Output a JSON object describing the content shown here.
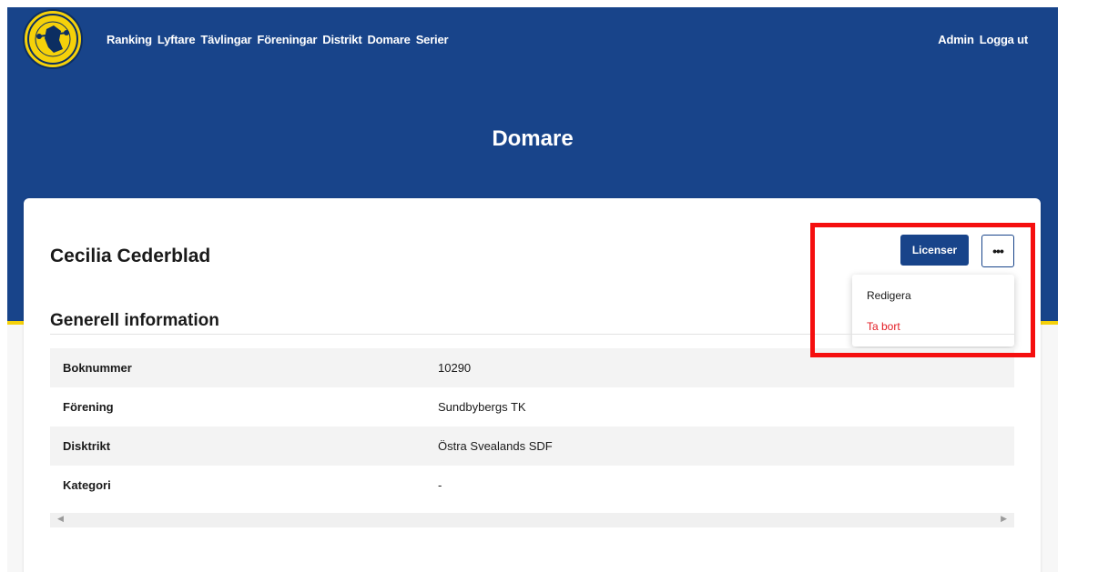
{
  "nav": {
    "items": [
      {
        "label": "Ranking"
      },
      {
        "label": "Lyftare"
      },
      {
        "label": "Tävlingar"
      },
      {
        "label": "Föreningar"
      },
      {
        "label": "Distrikt"
      },
      {
        "label": "Domare"
      },
      {
        "label": "Serier"
      }
    ],
    "right": [
      {
        "label": "Admin"
      },
      {
        "label": "Logga ut"
      }
    ],
    "logo_icon": "federation-logo-icon"
  },
  "page": {
    "title": "Domare"
  },
  "card": {
    "name": "Cecilia Cederblad",
    "section_title": "Generell information",
    "licenser_label": "Licenser",
    "more_label": "•••",
    "menu": {
      "edit_label": "Redigera",
      "delete_label": "Ta bort"
    },
    "rows": [
      {
        "label": "Boknummer",
        "value": "10290"
      },
      {
        "label": "Förening",
        "value": "Sundbybergs TK"
      },
      {
        "label": "Disktrikt",
        "value": "Östra Svealands SDF"
      },
      {
        "label": "Kategori",
        "value": "-"
      }
    ]
  },
  "colors": {
    "brand_blue": "#18448a",
    "brand_gold": "#f5d10a",
    "danger_red": "#e31b23",
    "highlight_red": "#f50f0f"
  }
}
